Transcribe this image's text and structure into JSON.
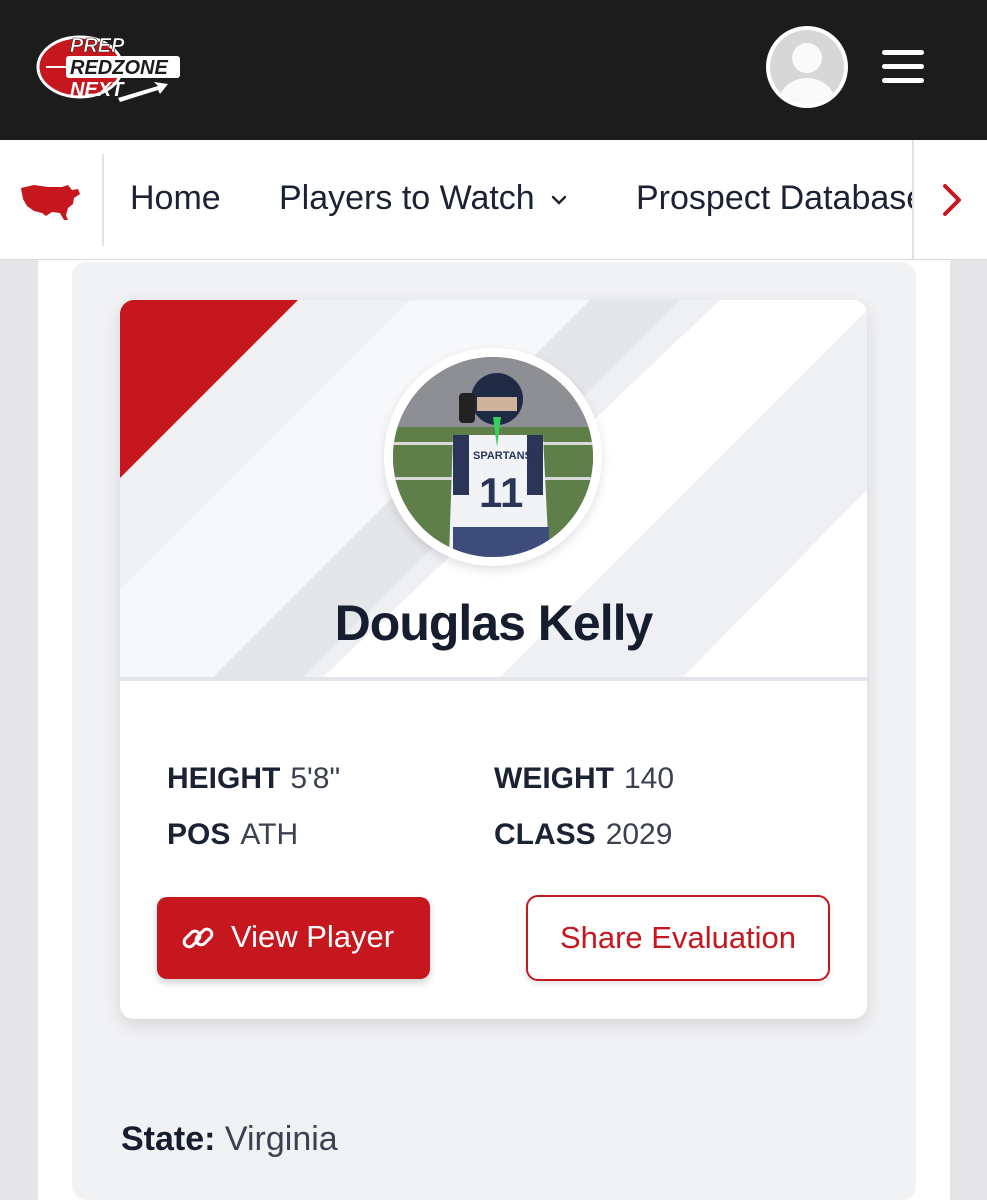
{
  "header": {
    "logo": {
      "line1": "PREP",
      "line2": "REDZONE",
      "line3": "NEXT"
    },
    "avatar_icon": "user-avatar-icon",
    "menu_icon": "hamburger-icon"
  },
  "nav": {
    "region_icon": "usa-map-icon",
    "items": [
      {
        "label": "Home"
      },
      {
        "label": "Players to Watch",
        "chevron": "⌄"
      },
      {
        "label": "Prospect Database"
      }
    ],
    "scroll_icon": "chevron-right-icon"
  },
  "player": {
    "name": "Douglas Kelly",
    "photo_icon": "player-photo",
    "stats": {
      "height_label": "HEIGHT",
      "height_value": "5'8\"",
      "weight_label": "WEIGHT",
      "weight_value": "140",
      "pos_label": "POS",
      "pos_value": "ATH",
      "class_label": "CLASS",
      "class_value": "2029"
    },
    "view_button": "View Player",
    "share_button": "Share Evaluation"
  },
  "details": {
    "state_label": "State:",
    "state_value": "Virginia"
  },
  "colors": {
    "brand_red": "#c5171d",
    "header_dark": "#1c1c1c",
    "text_dark": "#161d2e"
  }
}
